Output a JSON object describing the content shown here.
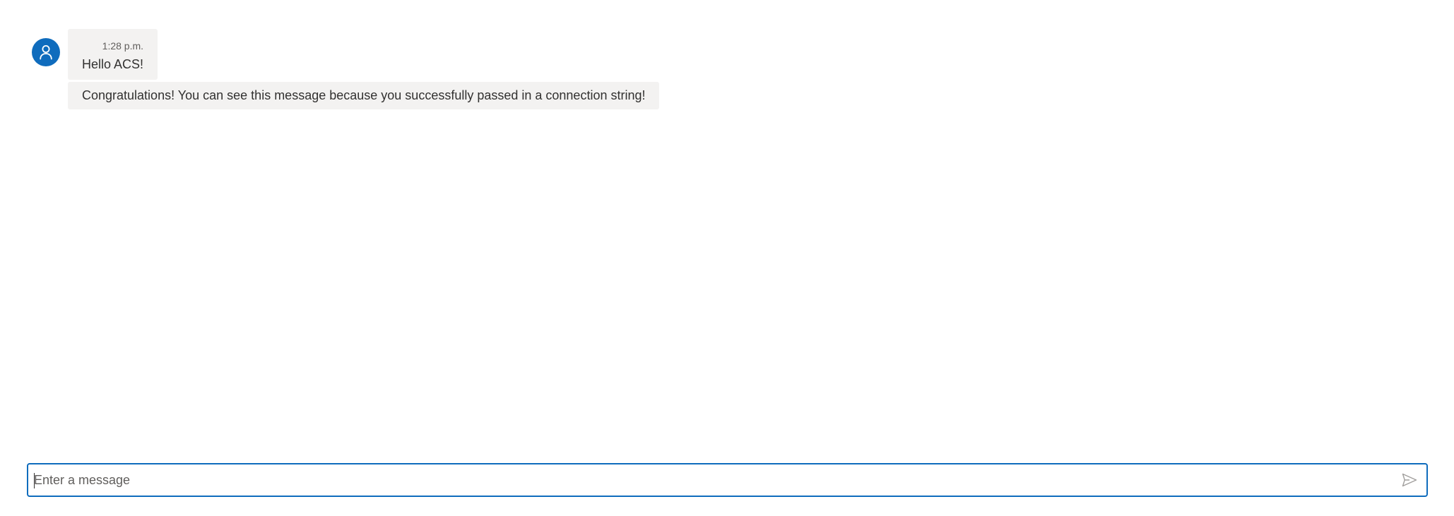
{
  "messages": [
    {
      "avatar_icon": "person-icon",
      "timestamp": "1:28 p.m.",
      "text": "Hello ACS!"
    },
    {
      "text": "Congratulations! You can see this message because you successfully passed in a connection string!"
    }
  ],
  "composer": {
    "placeholder": "Enter a message",
    "value": "",
    "send_icon": "send-icon"
  },
  "colors": {
    "accent": "#0f6cbd",
    "bubble_bg": "#f3f2f1",
    "text": "#323130",
    "muted_text": "#605e5c"
  }
}
